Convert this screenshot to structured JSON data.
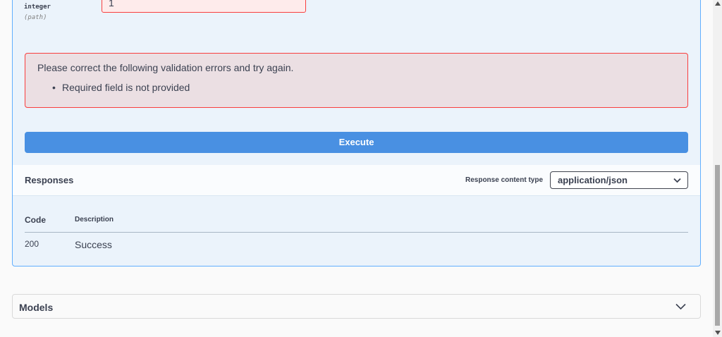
{
  "parameter": {
    "type": "integer",
    "location": "(path)",
    "value": "1"
  },
  "validation": {
    "message": "Please correct the following validation errors and try again.",
    "errors": [
      "Required field is not provided"
    ]
  },
  "execute_label": "Execute",
  "responses": {
    "title": "Responses",
    "content_type_label": "Response content type",
    "content_type_value": "application/json",
    "columns": {
      "code": "Code",
      "description": "Description"
    },
    "rows": [
      {
        "code": "200",
        "description": "Success"
      }
    ]
  },
  "models": {
    "title": "Models"
  },
  "colors": {
    "accent": "#4990e2",
    "error_border": "#f93e3e",
    "error_bg": "#ebdfe3",
    "block_bg": "#ebf3fb"
  },
  "icons": {
    "select_chevron": "chevron-down-icon",
    "models_chevron": "chevron-down-icon"
  }
}
